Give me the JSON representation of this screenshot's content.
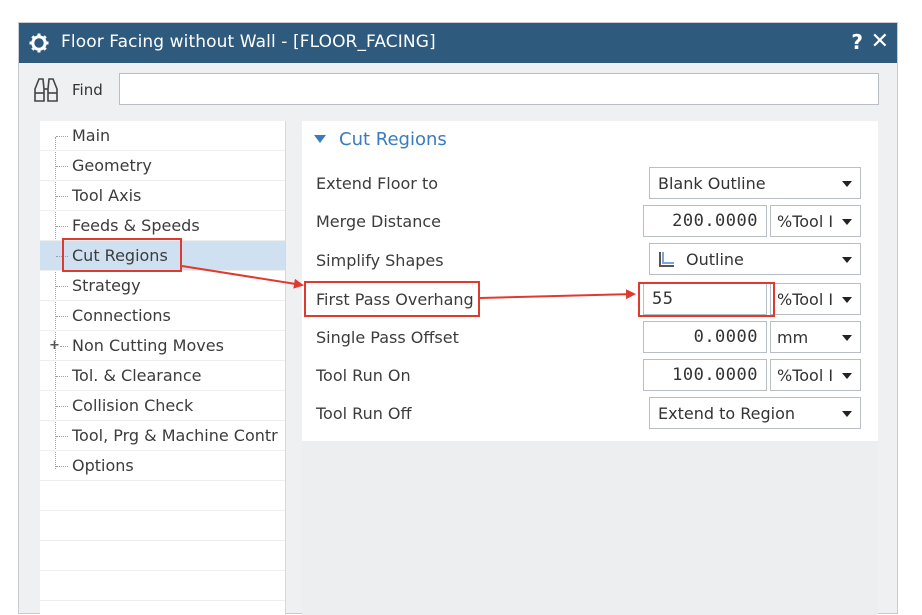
{
  "window": {
    "title": "Floor Facing without Wall - [FLOOR_FACING]",
    "icon": "gear-icon",
    "help_label": "?",
    "close_label": "✕"
  },
  "find": {
    "label": "Find",
    "icon": "binoculars-icon",
    "value": "",
    "placeholder": ""
  },
  "tree": {
    "items": [
      {
        "label": "Main"
      },
      {
        "label": "Geometry"
      },
      {
        "label": "Tool Axis"
      },
      {
        "label": "Feeds & Speeds"
      },
      {
        "label": "Cut Regions",
        "selected": true
      },
      {
        "label": "Strategy"
      },
      {
        "label": "Connections"
      },
      {
        "label": "Non Cutting Moves",
        "expandable": true
      },
      {
        "label": "Tol. & Clearance"
      },
      {
        "label": "Collision Check"
      },
      {
        "label": "Tool, Prg & Machine Contr"
      },
      {
        "label": "Options"
      }
    ],
    "expand_symbol": "+"
  },
  "section": {
    "title": "Cut Regions",
    "properties": [
      {
        "label": "Extend Floor to",
        "dropdown": "Blank Outline"
      },
      {
        "label": "Merge Distance",
        "value": "200.0000",
        "unit": "%Tool I"
      },
      {
        "label": "Simplify Shapes",
        "dropdown": "Outline",
        "icon": "outline-shape-icon"
      },
      {
        "label": "First Pass Overhang",
        "value": "55",
        "unit": "%Tool I"
      },
      {
        "label": "Single Pass Offset",
        "value": "0.0000",
        "unit": "mm"
      },
      {
        "label": "Tool Run On",
        "value": "100.0000",
        "unit": "%Tool I"
      },
      {
        "label": "Tool Run Off",
        "dropdown": "Extend to Region"
      }
    ]
  },
  "colors": {
    "titlebar": "#2e5a7e",
    "selection": "#cfe1f1",
    "accent": "#3a7bbf",
    "highlight": "#e03a2e"
  }
}
